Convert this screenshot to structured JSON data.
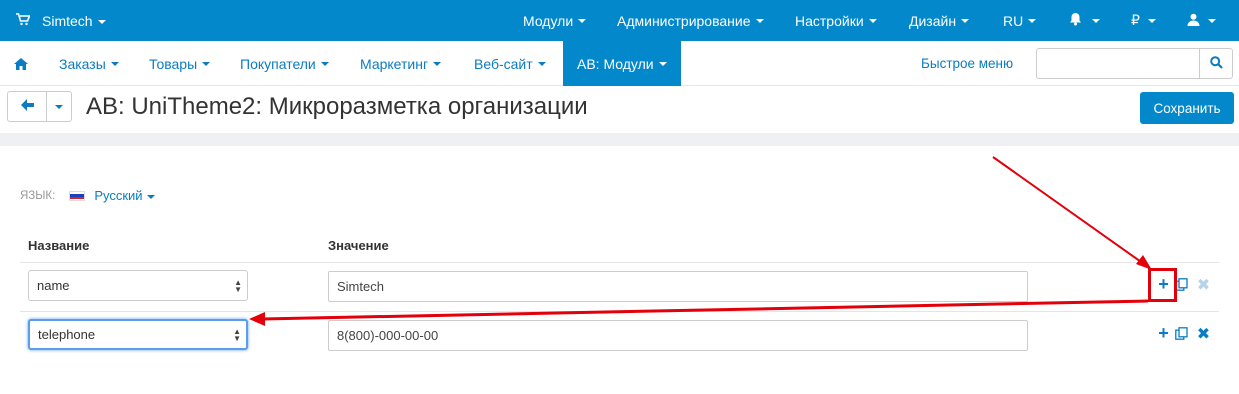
{
  "colors": {
    "brand": "#0388cc",
    "link": "#0b7cc2",
    "annotation": "#e2000b",
    "focus": "#5b9ded"
  },
  "topbar": {
    "brand": "Simtech",
    "items": [
      "Модули",
      "Администрирование",
      "Настройки",
      "Дизайн",
      "RU"
    ],
    "currency": "₽",
    "icons": [
      "cart-icon",
      "bell-icon",
      "user-icon"
    ]
  },
  "nav": {
    "items": [
      "Заказы",
      "Товары",
      "Покупатели",
      "Маркетинг",
      "Веб-сайт",
      "AB: Модули"
    ],
    "quick_menu": "Быстрое меню",
    "search_value": ""
  },
  "page": {
    "title": "AB: UniTheme2: Микроразметка организации",
    "save_label": "Сохранить"
  },
  "language": {
    "label": "ЯЗЫК:",
    "selected": "Русский"
  },
  "table": {
    "headers": {
      "name": "Название",
      "value": "Значение"
    },
    "rows": [
      {
        "name": "name",
        "value": "Simtech"
      },
      {
        "name": "telephone",
        "value": "8(800)-000-00-00"
      }
    ]
  }
}
